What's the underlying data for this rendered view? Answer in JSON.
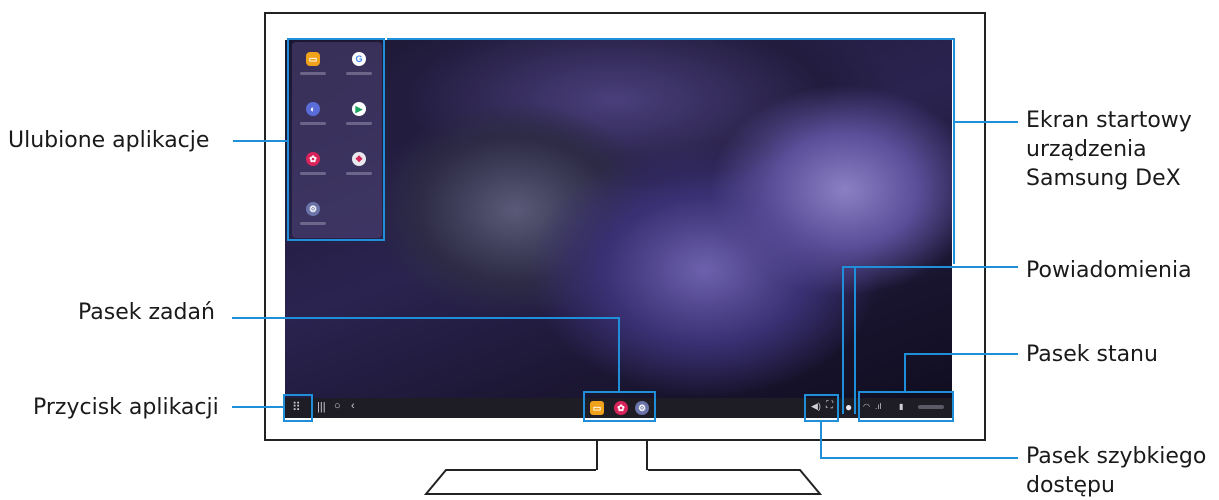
{
  "callouts": {
    "favorites": "Ulubione aplikacje",
    "home_line1": "Ekran startowy",
    "home_line2": "urządzenia",
    "home_line3": "Samsung DeX",
    "notifications": "Powiadomienia",
    "taskbar": "Pasek zadań",
    "statusbar": "Pasek stanu",
    "apps_button": "Przycisk aplikacji",
    "quick_line1": "Pasek szybkiego",
    "quick_line2": "dostępu"
  },
  "favorite_apps": [
    {
      "icon": "folder-icon",
      "color": "#f0a21a"
    },
    {
      "icon": "google-icon",
      "color": "#ffffff"
    },
    {
      "icon": "internet-icon",
      "color": "#5a6cd8"
    },
    {
      "icon": "play-store-icon",
      "color": "#ffffff"
    },
    {
      "icon": "gallery-icon",
      "color": "#d8245a"
    },
    {
      "icon": "galaxy-store-icon",
      "color": "#e8e8ee"
    },
    {
      "icon": "settings-icon",
      "color": "#6a74a8"
    }
  ],
  "taskbar_apps": [
    {
      "icon": "folder-icon",
      "color": "#f0a21a"
    },
    {
      "icon": "gallery-icon",
      "color": "#d8245a"
    },
    {
      "icon": "settings-icon",
      "color": "#6a74a8"
    }
  ],
  "accent_color": "#1e8fd8"
}
